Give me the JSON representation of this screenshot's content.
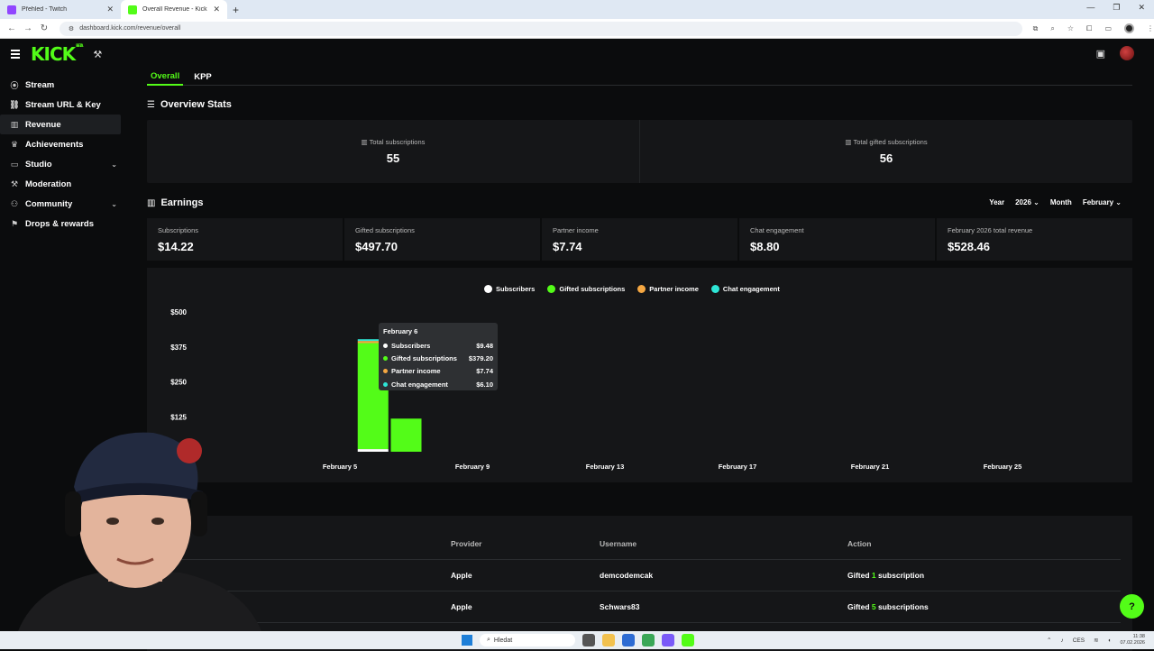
{
  "browser": {
    "tabs": [
      {
        "title": "Přehled - Twitch",
        "active": false
      },
      {
        "title": "Overall Revenue - Kick Dashbo",
        "active": true
      }
    ],
    "url": "dashboard.kick.com/revenue/overall"
  },
  "header": {
    "logo": "KICK",
    "beta": "BETA"
  },
  "sidebar": {
    "items": [
      {
        "label": "Stream",
        "icon": "broadcast-icon"
      },
      {
        "label": "Stream URL & Key",
        "icon": "link-icon"
      },
      {
        "label": "Revenue",
        "icon": "chart-icon",
        "active": true
      },
      {
        "label": "Achievements",
        "icon": "trophy-icon"
      },
      {
        "label": "Studio",
        "icon": "monitor-icon",
        "expandable": true
      },
      {
        "label": "Moderation",
        "icon": "hammer-icon"
      },
      {
        "label": "Community",
        "icon": "people-icon",
        "expandable": true
      },
      {
        "label": "Drops & rewards",
        "icon": "gift-icon"
      }
    ]
  },
  "subtabs": [
    "Overall",
    "KPP"
  ],
  "overview": {
    "title": "Overview Stats",
    "stats": [
      {
        "label": "Total subscriptions",
        "value": "55"
      },
      {
        "label": "Total gifted subscriptions",
        "value": "56"
      }
    ]
  },
  "earnings": {
    "title": "Earnings",
    "year_label": "Year",
    "year_value": "2026",
    "month_label": "Month",
    "month_value": "February",
    "cards": [
      {
        "label": "Subscriptions",
        "value": "$14.22"
      },
      {
        "label": "Gifted subscriptions",
        "value": "$497.70"
      },
      {
        "label": "Partner income",
        "value": "$7.74"
      },
      {
        "label": "Chat engagement",
        "value": "$8.80"
      },
      {
        "label": "February 2026 total revenue",
        "value": "$528.46"
      }
    ]
  },
  "chart_data": {
    "type": "bar",
    "stacked": true,
    "legend": [
      {
        "name": "Subscribers",
        "color": "#ffffff"
      },
      {
        "name": "Gifted subscriptions",
        "color": "#53fc18"
      },
      {
        "name": "Partner income",
        "color": "#f5a742"
      },
      {
        "name": "Chat engagement",
        "color": "#2ee6d6"
      }
    ],
    "yticks": [
      "$500",
      "$375",
      "$250",
      "$125"
    ],
    "ylim": [
      0,
      500
    ],
    "xticks": [
      "February 5",
      "February 9",
      "February 13",
      "February 17",
      "February 21",
      "February 25"
    ],
    "bars": [
      {
        "date": "February 6",
        "values": {
          "Subscribers": 9.48,
          "Gifted subscriptions": 379.2,
          "Partner income": 7.74,
          "Chat engagement": 6.1
        }
      },
      {
        "date": "February 7",
        "values": {
          "Subscribers": 0,
          "Gifted subscriptions": 118.5,
          "Partner income": 0,
          "Chat engagement": 0
        }
      }
    ],
    "tooltip": {
      "date": "February 6",
      "rows": [
        {
          "name": "Subscribers",
          "value": "$9.48",
          "color": "#ffffff"
        },
        {
          "name": "Gifted subscriptions",
          "value": "$379.20",
          "color": "#53fc18"
        },
        {
          "name": "Partner income",
          "value": "$7.74",
          "color": "#f5a742"
        },
        {
          "name": "Chat engagement",
          "value": "$6.10",
          "color": "#2ee6d6"
        }
      ]
    }
  },
  "table": {
    "headers": [
      "Provider",
      "Username",
      "Action"
    ],
    "rows": [
      {
        "provider": "Apple",
        "username": "demcodemcak",
        "action_prefix": "Gifted ",
        "count": "1",
        "action_suffix": " subscription"
      },
      {
        "provider": "Apple",
        "username": "Schwars83",
        "action_prefix": "Gifted ",
        "count": "5",
        "action_suffix": " subscriptions"
      }
    ]
  },
  "taskbar": {
    "search_placeholder": "Hledat",
    "lang": "CES",
    "time": "11:38",
    "date": "07.02.2026"
  }
}
